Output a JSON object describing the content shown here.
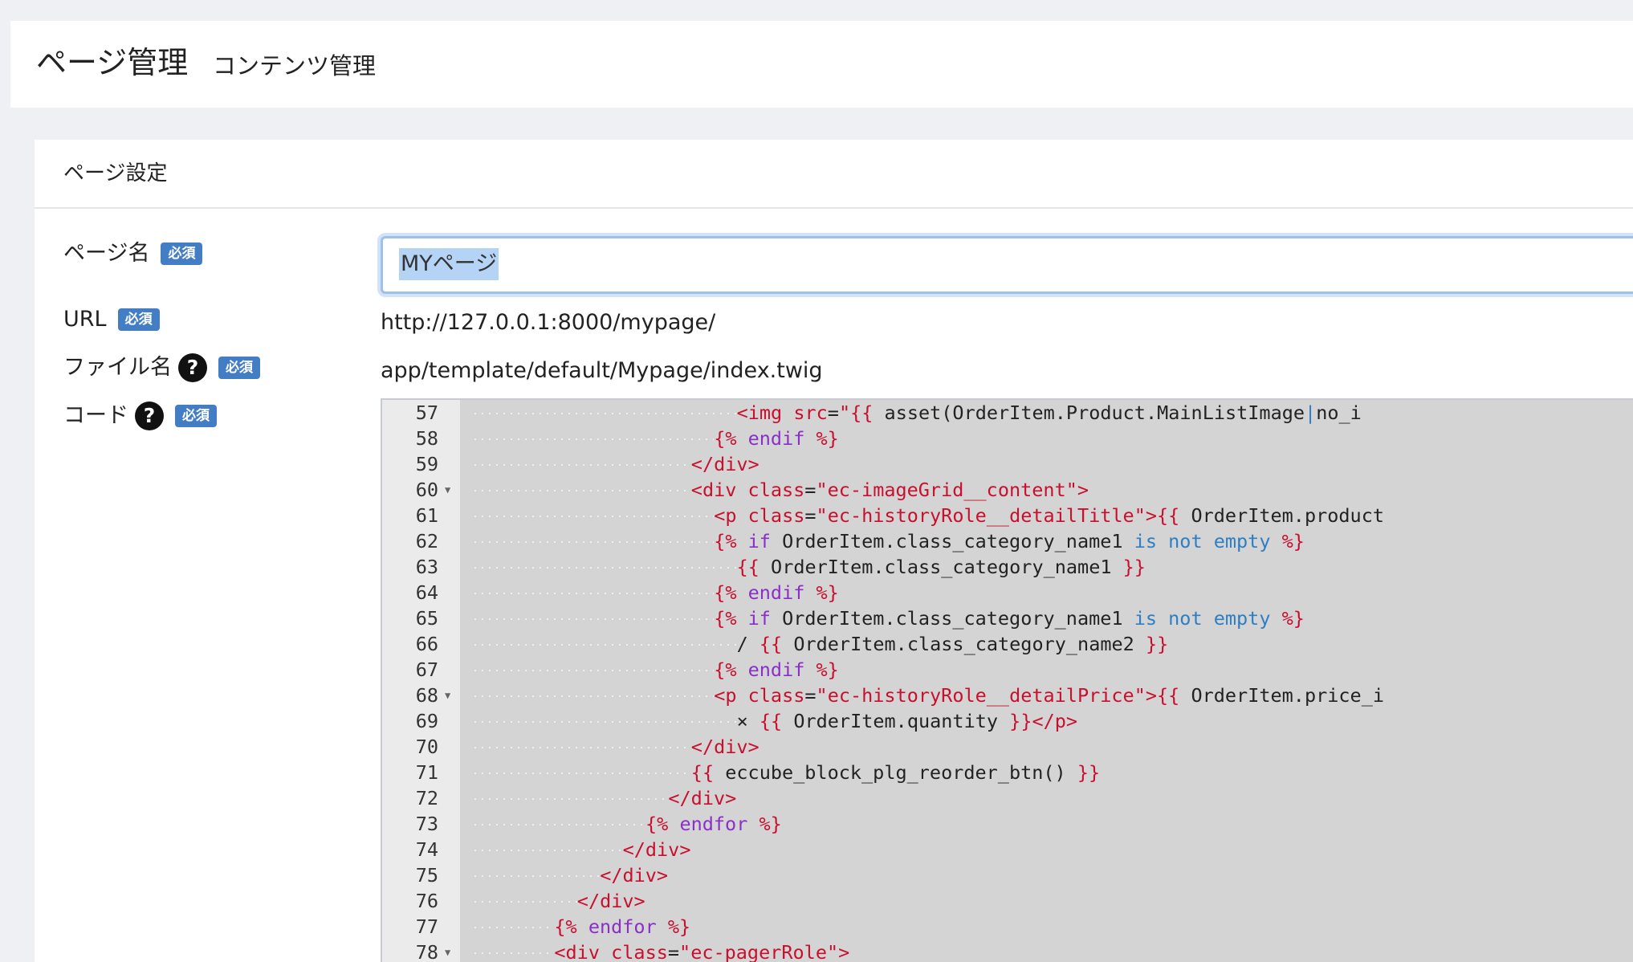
{
  "header": {
    "title": "ページ管理",
    "subtitle": "コンテンツ管理"
  },
  "card": {
    "title": "ページ設定"
  },
  "form": {
    "required_badge": "必須",
    "page_name": {
      "label": "ページ名",
      "value": "MYページ"
    },
    "url": {
      "label": "URL",
      "value": "http://127.0.0.1:8000/mypage/"
    },
    "file_name": {
      "label": "ファイル名",
      "value": "app/template/default/Mypage/index.twig"
    },
    "code": {
      "label": "コード"
    },
    "help_icon_glyph": "?"
  },
  "editor": {
    "lines": [
      {
        "n": "57",
        "fold": false,
        "indent": 23,
        "tokens": [
          [
            "t-tag",
            "<img "
          ],
          [
            "t-attr",
            "src"
          ],
          [
            "t-txt",
            "="
          ],
          [
            "t-str",
            "\"{{ "
          ],
          [
            "t-txt",
            "asset(OrderItem.Product.MainListImage"
          ],
          [
            "t-op",
            "|"
          ],
          [
            "t-txt",
            "no_i"
          ]
        ]
      },
      {
        "n": "58",
        "fold": false,
        "indent": 21,
        "tokens": [
          [
            "t-br",
            "{% "
          ],
          [
            "t-kw",
            "endif"
          ],
          [
            "t-br",
            " %}"
          ]
        ]
      },
      {
        "n": "59",
        "fold": false,
        "indent": 19,
        "tokens": [
          [
            "t-tag",
            "</div>"
          ]
        ]
      },
      {
        "n": "60",
        "fold": true,
        "indent": 19,
        "tokens": [
          [
            "t-tag",
            "<div "
          ],
          [
            "t-attr",
            "class"
          ],
          [
            "t-txt",
            "="
          ],
          [
            "t-str",
            "\"ec-imageGrid__content\""
          ],
          [
            "t-tag",
            ">"
          ]
        ]
      },
      {
        "n": "61",
        "fold": false,
        "indent": 21,
        "tokens": [
          [
            "t-tag",
            "<p "
          ],
          [
            "t-attr",
            "class"
          ],
          [
            "t-txt",
            "="
          ],
          [
            "t-str",
            "\"ec-historyRole__detailTitle\""
          ],
          [
            "t-tag",
            ">"
          ],
          [
            "t-br",
            "{{ "
          ],
          [
            "t-txt",
            "OrderItem.product"
          ]
        ]
      },
      {
        "n": "62",
        "fold": false,
        "indent": 21,
        "tokens": [
          [
            "t-br",
            "{% "
          ],
          [
            "t-kw",
            "if "
          ],
          [
            "t-txt",
            "OrderItem.class_category_name1 "
          ],
          [
            "t-op",
            "is not empty"
          ],
          [
            "t-br",
            " %}"
          ]
        ]
      },
      {
        "n": "63",
        "fold": false,
        "indent": 23,
        "tokens": [
          [
            "t-br",
            "{{ "
          ],
          [
            "t-txt",
            "OrderItem.class_category_name1 "
          ],
          [
            "t-br",
            "}}"
          ]
        ]
      },
      {
        "n": "64",
        "fold": false,
        "indent": 21,
        "tokens": [
          [
            "t-br",
            "{% "
          ],
          [
            "t-kw",
            "endif"
          ],
          [
            "t-br",
            " %}"
          ]
        ]
      },
      {
        "n": "65",
        "fold": false,
        "indent": 21,
        "tokens": [
          [
            "t-br",
            "{% "
          ],
          [
            "t-kw",
            "if "
          ],
          [
            "t-txt",
            "OrderItem.class_category_name1 "
          ],
          [
            "t-op",
            "is not empty"
          ],
          [
            "t-br",
            " %}"
          ]
        ]
      },
      {
        "n": "66",
        "fold": false,
        "indent": 23,
        "tokens": [
          [
            "t-txt",
            "/ "
          ],
          [
            "t-br",
            "{{ "
          ],
          [
            "t-txt",
            "OrderItem.class_category_name2 "
          ],
          [
            "t-br",
            "}}"
          ]
        ]
      },
      {
        "n": "67",
        "fold": false,
        "indent": 21,
        "tokens": [
          [
            "t-br",
            "{% "
          ],
          [
            "t-kw",
            "endif"
          ],
          [
            "t-br",
            " %}"
          ]
        ]
      },
      {
        "n": "68",
        "fold": true,
        "indent": 21,
        "tokens": [
          [
            "t-tag",
            "<p "
          ],
          [
            "t-attr",
            "class"
          ],
          [
            "t-txt",
            "="
          ],
          [
            "t-str",
            "\"ec-historyRole__detailPrice\""
          ],
          [
            "t-tag",
            ">"
          ],
          [
            "t-br",
            "{{ "
          ],
          [
            "t-txt",
            "OrderItem.price_i"
          ]
        ]
      },
      {
        "n": "69",
        "fold": false,
        "indent": 23,
        "tokens": [
          [
            "t-txt",
            "× "
          ],
          [
            "t-br",
            "{{ "
          ],
          [
            "t-txt",
            "OrderItem.quantity "
          ],
          [
            "t-br",
            "}}"
          ],
          [
            "t-tag",
            "</p>"
          ]
        ]
      },
      {
        "n": "70",
        "fold": false,
        "indent": 19,
        "tokens": [
          [
            "t-tag",
            "</div>"
          ]
        ]
      },
      {
        "n": "71",
        "fold": false,
        "indent": 19,
        "tokens": [
          [
            "t-br",
            "{{ "
          ],
          [
            "t-txt",
            "eccube_block_plg_reorder_btn() "
          ],
          [
            "t-br",
            "}}"
          ]
        ]
      },
      {
        "n": "72",
        "fold": false,
        "indent": 17,
        "tokens": [
          [
            "t-tag",
            "</div>"
          ]
        ]
      },
      {
        "n": "73",
        "fold": false,
        "indent": 15,
        "tokens": [
          [
            "t-br",
            "{% "
          ],
          [
            "t-kw",
            "endfor"
          ],
          [
            "t-br",
            " %}"
          ]
        ]
      },
      {
        "n": "74",
        "fold": false,
        "indent": 13,
        "tokens": [
          [
            "t-tag",
            "</div>"
          ]
        ]
      },
      {
        "n": "75",
        "fold": false,
        "indent": 11,
        "tokens": [
          [
            "t-tag",
            "</div>"
          ]
        ]
      },
      {
        "n": "76",
        "fold": false,
        "indent": 9,
        "tokens": [
          [
            "t-tag",
            "</div>"
          ]
        ]
      },
      {
        "n": "77",
        "fold": false,
        "indent": 7,
        "tokens": [
          [
            "t-br",
            "{% "
          ],
          [
            "t-kw",
            "endfor"
          ],
          [
            "t-br",
            " %}"
          ]
        ]
      },
      {
        "n": "78",
        "fold": true,
        "indent": 7,
        "tokens": [
          [
            "t-tag",
            "<div "
          ],
          [
            "t-attr",
            "class"
          ],
          [
            "t-txt",
            "="
          ],
          [
            "t-str",
            "\"ec-pagerRole\""
          ],
          [
            "t-tag",
            ">"
          ]
        ]
      }
    ]
  }
}
